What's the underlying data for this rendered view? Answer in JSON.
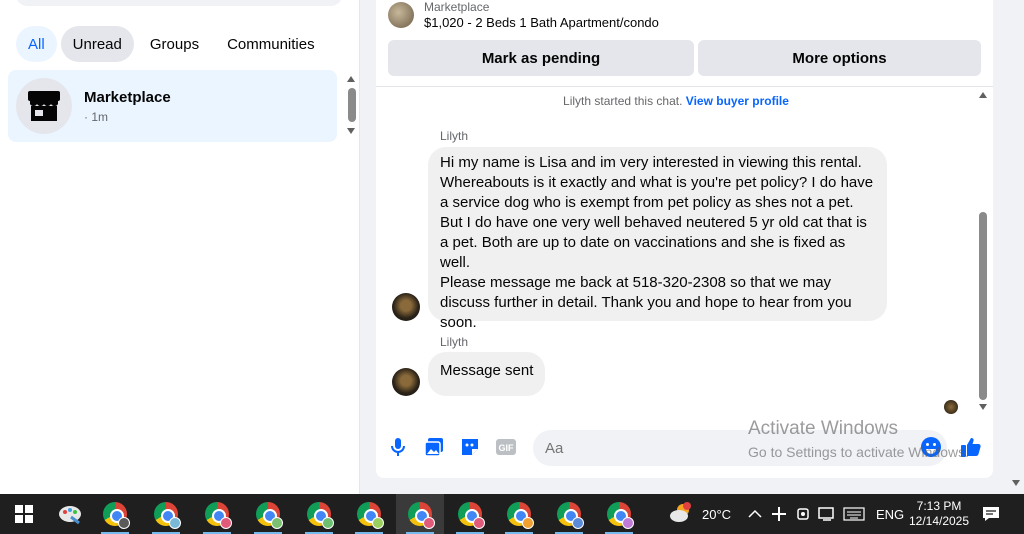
{
  "filters": [
    "All",
    "Unread",
    "Groups",
    "Communities"
  ],
  "conversation": {
    "name": "Marketplace",
    "time": "· 1m"
  },
  "listing": {
    "label": "Marketplace",
    "title": "$1,020 - 2 Beds 1 Bath Apartment/condo"
  },
  "actions": {
    "mark_pending": "Mark as pending",
    "more_options": "More options"
  },
  "chat": {
    "started_text": "Lilyth started this chat.",
    "view_profile": "View buyer profile",
    "messages": [
      {
        "sender": "Lilyth",
        "lines": [
          "Hi my name is Lisa and im very interested in viewing this rental.",
          "Whereabouts is it exactly and what is you're pet policy? I do have",
          "a service dog who is exempt from pet policy as shes not a pet.",
          "But I do have one very well behaved neutered 5 yr old cat that is",
          "a pet. Both are up to date on vaccinations and she is fixed as well.",
          "Please message me back at 518-320-2308  so that we may",
          "discuss further in detail. Thank you and hope to hear from you",
          "soon."
        ]
      },
      {
        "sender": "Lilyth",
        "lines": [
          "Message sent"
        ]
      }
    ]
  },
  "composer": {
    "placeholder": "Aa"
  },
  "watermark": {
    "line1": "Activate Windows",
    "line2": "Go to Settings to activate Windows."
  },
  "taskbar": {
    "weather": "20°C",
    "language": "ENG",
    "time": "7:13 PM",
    "date": "12/14/2025",
    "chrome_profiles": [
      "#5a5a5a",
      "#7ab8d8",
      "#e05a7a",
      "#7ac070",
      "#6cc070",
      "#9acf60",
      "#e05a7a",
      "#e05a7a",
      "#f0a030",
      "#5a8ad8",
      "#c07ad8"
    ]
  },
  "colors": {
    "accent": "#0866ff"
  }
}
